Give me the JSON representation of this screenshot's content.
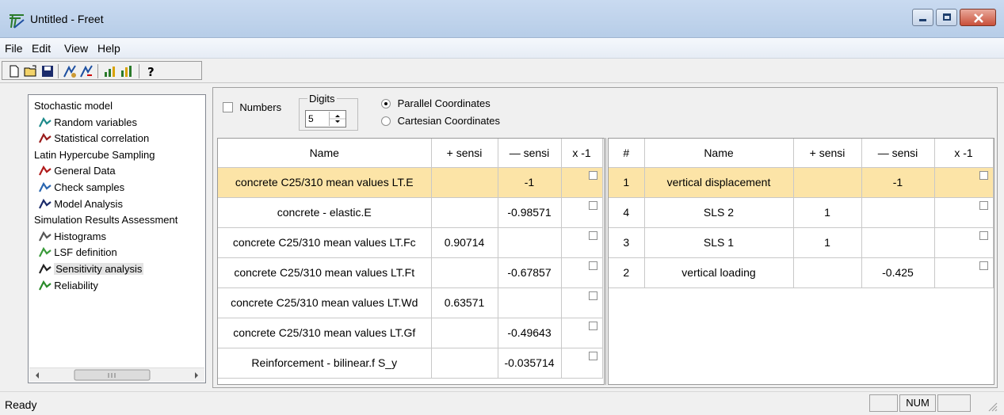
{
  "window": {
    "title": "Untitled - Freet"
  },
  "menu": [
    "File",
    "Edit",
    "View",
    "Help"
  ],
  "tree": [
    {
      "label": "Stochastic model",
      "icon": "",
      "level": 0
    },
    {
      "label": "Random variables",
      "icon": "distribution-icon",
      "level": 1
    },
    {
      "label": "Statistical correlation",
      "icon": "correlation-matrix-icon",
      "level": 1
    },
    {
      "label": "Latin Hypercube Sampling",
      "icon": "",
      "level": 0
    },
    {
      "label": "General Data",
      "icon": "general-data-icon",
      "level": 1
    },
    {
      "label": "Check samples",
      "icon": "check-samples-icon",
      "level": 1
    },
    {
      "label": "Model Analysis",
      "icon": "model-analysis-icon",
      "level": 1
    },
    {
      "label": "Simulation Results Assessment",
      "icon": "",
      "level": 0
    },
    {
      "label": "Histograms",
      "icon": "histogram-icon",
      "level": 1
    },
    {
      "label": "LSF definition",
      "icon": "lsf-icon",
      "level": 1
    },
    {
      "label": "Sensitivity analysis",
      "icon": "sensitivity-icon",
      "level": 1,
      "selected": true
    },
    {
      "label": "Reliability",
      "icon": "reliability-icon",
      "level": 1
    }
  ],
  "options": {
    "numbers_label": "Numbers",
    "digits_label": "Digits",
    "digits_value": "5",
    "parallel_label": "Parallel Coordinates",
    "cartesian_label": "Cartesian Coordinates"
  },
  "left_table": {
    "headers": [
      "Name",
      "+ sensi",
      "— sensi",
      "x -1"
    ],
    "rows": [
      [
        "concrete C25/310 mean values LT.E",
        "",
        "-1",
        ""
      ],
      [
        "concrete - elastic.E",
        "",
        "-0.98571",
        ""
      ],
      [
        "concrete C25/310 mean values LT.Fc",
        "0.90714",
        "",
        ""
      ],
      [
        "concrete C25/310 mean values LT.Ft",
        "",
        "-0.67857",
        ""
      ],
      [
        "concrete C25/310 mean values LT.Wd",
        "0.63571",
        "",
        ""
      ],
      [
        "concrete C25/310 mean values LT.Gf",
        "",
        "-0.49643",
        ""
      ],
      [
        "Reinforcement - bilinear.f S_y",
        "",
        "-0.035714",
        ""
      ]
    ]
  },
  "right_table": {
    "headers": [
      "#",
      "Name",
      "+ sensi",
      "— sensi",
      "x -1"
    ],
    "rows": [
      [
        "1",
        "vertical displacement",
        "",
        "-1",
        ""
      ],
      [
        "4",
        "SLS 2",
        "1",
        "",
        ""
      ],
      [
        "3",
        "SLS 1",
        "1",
        "",
        ""
      ],
      [
        "2",
        "vertical loading",
        "",
        "-0.425",
        ""
      ]
    ]
  },
  "status": {
    "text": "Ready",
    "num": "NUM"
  }
}
